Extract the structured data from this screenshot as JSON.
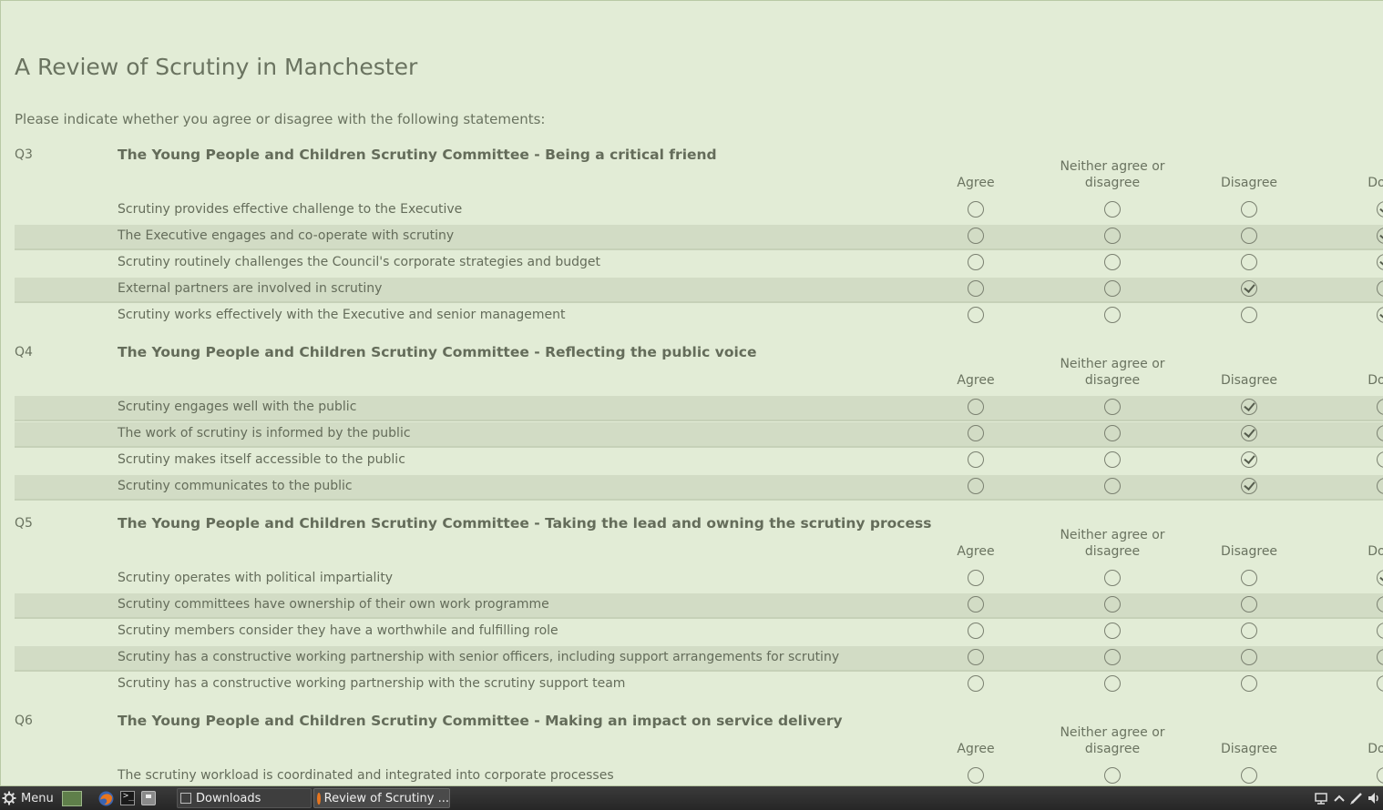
{
  "page": {
    "title": "A Review of Scrutiny in Manchester",
    "instruction": "Please indicate whether you agree or disagree with the following statements:"
  },
  "scale_headers": [
    "Agree",
    "Neither agree or disagree",
    "Disagree",
    "Don't"
  ],
  "scale_headers_lines": {
    "agree": "Agree",
    "neither_line1": "Neither agree or",
    "neither_line2": "disagree",
    "disagree": "Disagree",
    "dont": "Don't"
  },
  "questions": [
    {
      "num": "Q3",
      "title": "The Young People and Children Scrutiny Committee - Being a critical friend",
      "rows": [
        {
          "label": "Scrutiny provides effective challenge to the Executive",
          "selected": "dont"
        },
        {
          "label": "The Executive engages and co-operate with scrutiny",
          "selected": "dont"
        },
        {
          "label": "Scrutiny routinely challenges the Council's corporate strategies and budget",
          "selected": "dont"
        },
        {
          "label": "External partners are involved in scrutiny",
          "selected": "disagree"
        },
        {
          "label": "Scrutiny works effectively with the Executive and senior management",
          "selected": "dont"
        }
      ]
    },
    {
      "num": "Q4",
      "title": "The Young People and Children Scrutiny Committee - Reflecting the public voice",
      "rows": [
        {
          "label": "Scrutiny engages well with the public",
          "selected": "disagree"
        },
        {
          "label": "The work of scrutiny is informed by the public",
          "selected": "disagree"
        },
        {
          "label": "Scrutiny makes itself accessible to the public",
          "selected": "disagree"
        },
        {
          "label": "Scrutiny communicates to the public",
          "selected": "disagree"
        }
      ]
    },
    {
      "num": "Q5",
      "title": "The Young People and Children Scrutiny Committee - Taking the lead and owning the scrutiny process",
      "rows": [
        {
          "label": "Scrutiny operates with political impartiality",
          "selected": "dont"
        },
        {
          "label": "Scrutiny committees have ownership of their own work programme",
          "selected": ""
        },
        {
          "label": "Scrutiny members consider they have a worthwhile and fulfilling role",
          "selected": ""
        },
        {
          "label": "Scrutiny has a constructive working partnership with senior officers, including support arrangements for scrutiny",
          "selected": ""
        },
        {
          "label": "Scrutiny has a constructive working partnership with the scrutiny support team",
          "selected": ""
        }
      ]
    },
    {
      "num": "Q6",
      "title": "The Young People and Children Scrutiny Committee - Making an impact on service delivery",
      "rows": [
        {
          "label": "The scrutiny workload is coordinated and integrated into corporate processes",
          "selected": ""
        }
      ]
    }
  ],
  "taskbar": {
    "menu_label": "Menu",
    "windows": [
      "Downloads",
      "Review of Scrutiny ..."
    ],
    "icons": [
      "gear-icon",
      "show-desktop-icon",
      "firefox-icon",
      "terminal-icon",
      "files-icon",
      "network-icon",
      "chevron-up-icon",
      "pen-icon",
      "volume-icon"
    ]
  },
  "colors": {
    "background": "#e2ecd6",
    "shaded_row": "#d2dcc5",
    "text": "#666e5e",
    "taskbar": "#2e2e2e"
  }
}
